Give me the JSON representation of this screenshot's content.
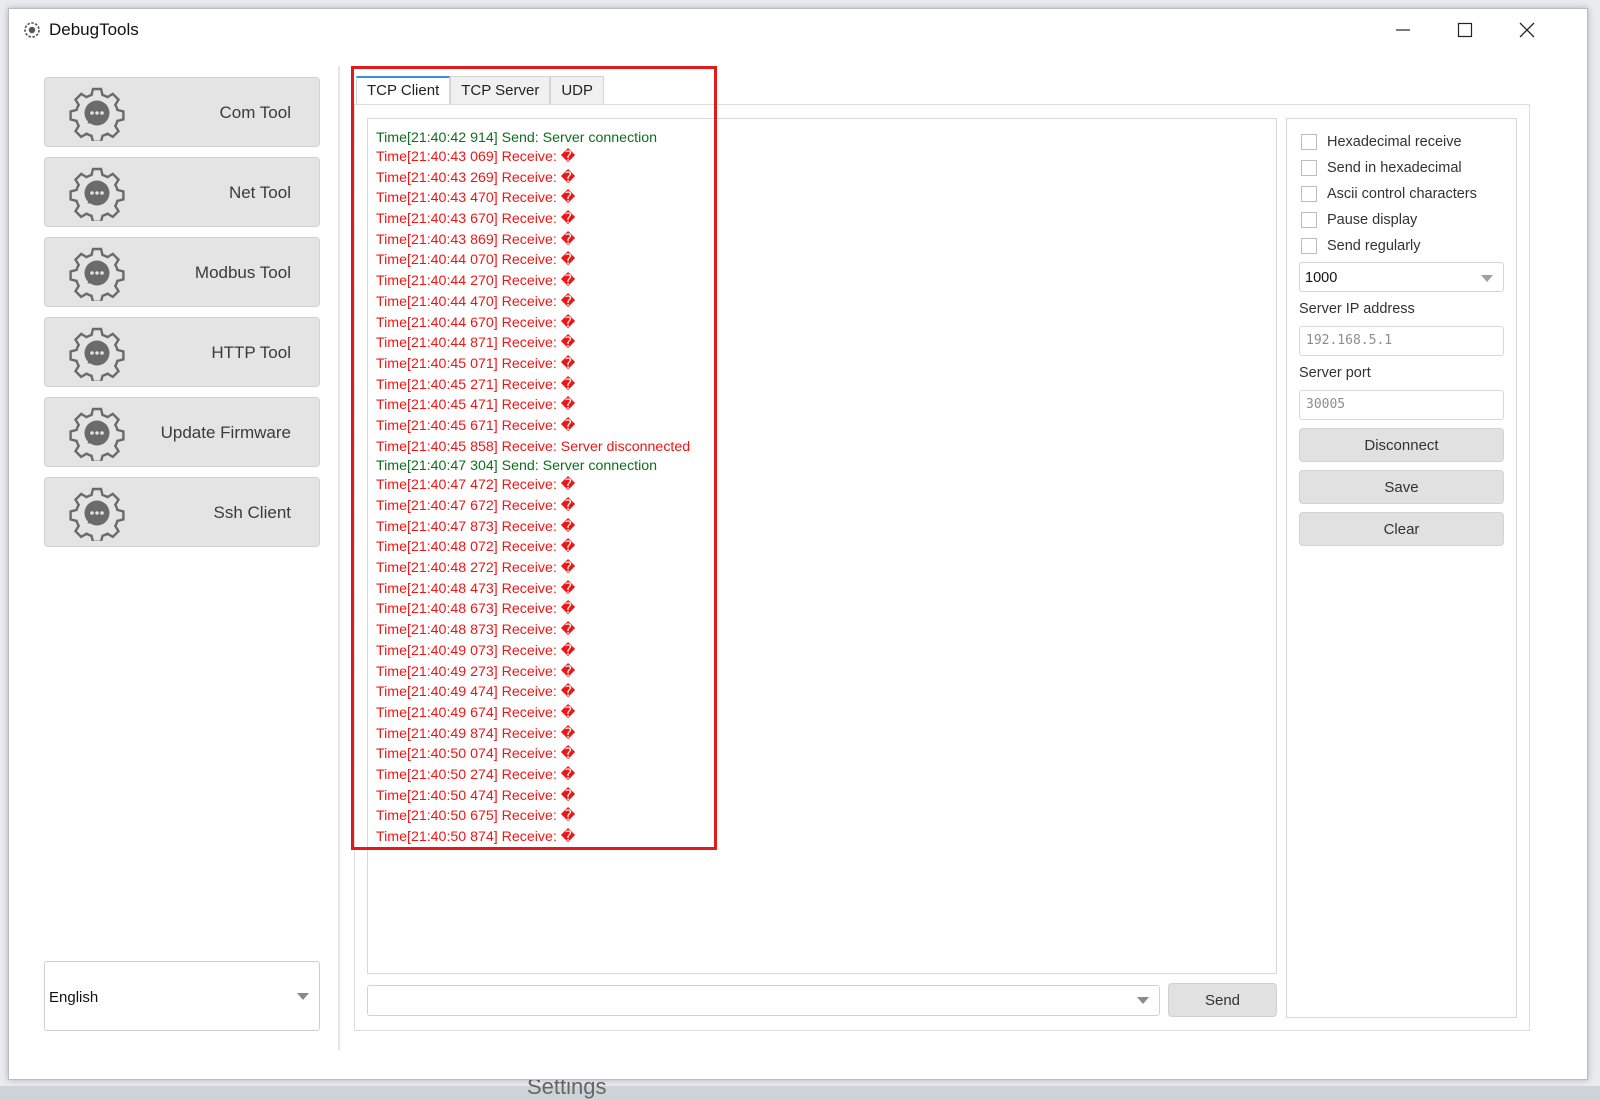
{
  "window": {
    "title": "DebugTools",
    "icon": "gear-icon"
  },
  "sidebar": {
    "items": [
      {
        "label": "Com Tool",
        "icon": "gear-chat-icon"
      },
      {
        "label": "Net Tool",
        "icon": "gear-chat-icon"
      },
      {
        "label": "Modbus Tool",
        "icon": "gear-chat-icon"
      },
      {
        "label": "HTTP Tool",
        "icon": "gear-chat-icon"
      },
      {
        "label": "Update Firmware",
        "icon": "gear-chat-icon"
      },
      {
        "label": "Ssh Client",
        "icon": "gear-chat-icon"
      }
    ],
    "language": "English"
  },
  "tabs": [
    {
      "label": "TCP Client",
      "active": true
    },
    {
      "label": "TCP Server",
      "active": false
    },
    {
      "label": "UDP",
      "active": false
    }
  ],
  "log": [
    {
      "text": "Time[21:40:42 914] Send: Server connection",
      "type": "send"
    },
    {
      "text": "Time[21:40:43 069] Receive: �",
      "type": "recv"
    },
    {
      "text": "Time[21:40:43 269] Receive: �",
      "type": "recv"
    },
    {
      "text": "Time[21:40:43 470] Receive: �",
      "type": "recv"
    },
    {
      "text": "Time[21:40:43 670] Receive: �",
      "type": "recv"
    },
    {
      "text": "Time[21:40:43 869] Receive: �",
      "type": "recv"
    },
    {
      "text": "Time[21:40:44 070] Receive: �",
      "type": "recv"
    },
    {
      "text": "Time[21:40:44 270] Receive: �",
      "type": "recv"
    },
    {
      "text": "Time[21:40:44 470] Receive: �",
      "type": "recv"
    },
    {
      "text": "Time[21:40:44 670] Receive: �",
      "type": "recv"
    },
    {
      "text": "Time[21:40:44 871] Receive: �",
      "type": "recv"
    },
    {
      "text": "Time[21:40:45 071] Receive: �",
      "type": "recv"
    },
    {
      "text": "Time[21:40:45 271] Receive: �",
      "type": "recv"
    },
    {
      "text": "Time[21:40:45 471] Receive: �",
      "type": "recv"
    },
    {
      "text": "Time[21:40:45 671] Receive: �",
      "type": "recv"
    },
    {
      "text": "Time[21:40:45 858] Receive: Server disconnected",
      "type": "recv"
    },
    {
      "text": "Time[21:40:47 304] Send: Server connection",
      "type": "send"
    },
    {
      "text": "Time[21:40:47 472] Receive: �",
      "type": "recv"
    },
    {
      "text": "Time[21:40:47 672] Receive: �",
      "type": "recv"
    },
    {
      "text": "Time[21:40:47 873] Receive: �",
      "type": "recv"
    },
    {
      "text": "Time[21:40:48 072] Receive: �",
      "type": "recv"
    },
    {
      "text": "Time[21:40:48 272] Receive: �",
      "type": "recv"
    },
    {
      "text": "Time[21:40:48 473] Receive: �",
      "type": "recv"
    },
    {
      "text": "Time[21:40:48 673] Receive: �",
      "type": "recv"
    },
    {
      "text": "Time[21:40:48 873] Receive: �",
      "type": "recv"
    },
    {
      "text": "Time[21:40:49 073] Receive: �",
      "type": "recv"
    },
    {
      "text": "Time[21:40:49 273] Receive: �",
      "type": "recv"
    },
    {
      "text": "Time[21:40:49 474] Receive: �",
      "type": "recv"
    },
    {
      "text": "Time[21:40:49 674] Receive: �",
      "type": "recv"
    },
    {
      "text": "Time[21:40:49 874] Receive: �",
      "type": "recv"
    },
    {
      "text": "Time[21:40:50 074] Receive: �",
      "type": "recv"
    },
    {
      "text": "Time[21:40:50 274] Receive: �",
      "type": "recv"
    },
    {
      "text": "Time[21:40:50 474] Receive: �",
      "type": "recv"
    },
    {
      "text": "Time[21:40:50 675] Receive: �",
      "type": "recv"
    },
    {
      "text": "Time[21:40:50 874] Receive: �",
      "type": "recv"
    }
  ],
  "send": {
    "input_value": "",
    "button_label": "Send"
  },
  "options": [
    {
      "label": "Hexadecimal receive",
      "checked": false
    },
    {
      "label": "Send in hexadecimal",
      "checked": false
    },
    {
      "label": "Ascii control characters",
      "checked": false
    },
    {
      "label": "Pause display",
      "checked": false
    },
    {
      "label": "Send regularly",
      "checked": false
    }
  ],
  "interval": "1000",
  "server_ip": {
    "label": "Server IP address",
    "value": "192.168.5.1"
  },
  "server_port": {
    "label": "Server port",
    "value": "30005"
  },
  "buttons": {
    "disconnect": "Disconnect",
    "save": "Save",
    "clear": "Clear"
  },
  "background_text": "Settings",
  "colors": {
    "send": "#0f6e1c",
    "receive": "#f01515",
    "highlight": "#e01b1b",
    "active_tab": "#3b8fe0"
  }
}
